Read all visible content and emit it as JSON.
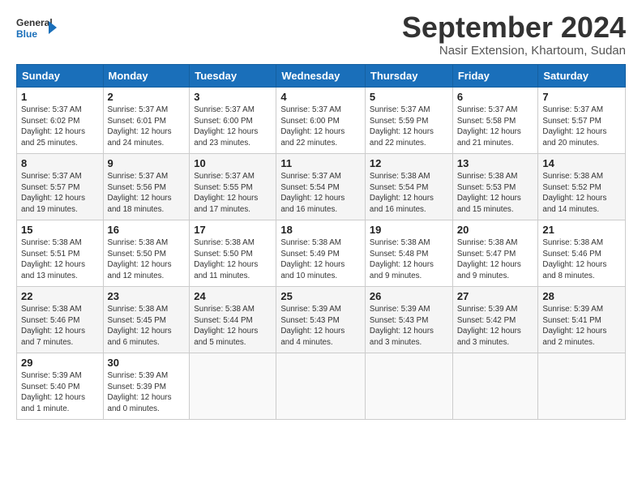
{
  "logo": {
    "line1": "General",
    "line2": "Blue"
  },
  "title": "September 2024",
  "location": "Nasir Extension, Khartoum, Sudan",
  "days_of_week": [
    "Sunday",
    "Monday",
    "Tuesday",
    "Wednesday",
    "Thursday",
    "Friday",
    "Saturday"
  ],
  "weeks": [
    [
      {
        "day": "1",
        "info": "Sunrise: 5:37 AM\nSunset: 6:02 PM\nDaylight: 12 hours\nand 25 minutes."
      },
      {
        "day": "2",
        "info": "Sunrise: 5:37 AM\nSunset: 6:01 PM\nDaylight: 12 hours\nand 24 minutes."
      },
      {
        "day": "3",
        "info": "Sunrise: 5:37 AM\nSunset: 6:00 PM\nDaylight: 12 hours\nand 23 minutes."
      },
      {
        "day": "4",
        "info": "Sunrise: 5:37 AM\nSunset: 6:00 PM\nDaylight: 12 hours\nand 22 minutes."
      },
      {
        "day": "5",
        "info": "Sunrise: 5:37 AM\nSunset: 5:59 PM\nDaylight: 12 hours\nand 22 minutes."
      },
      {
        "day": "6",
        "info": "Sunrise: 5:37 AM\nSunset: 5:58 PM\nDaylight: 12 hours\nand 21 minutes."
      },
      {
        "day": "7",
        "info": "Sunrise: 5:37 AM\nSunset: 5:57 PM\nDaylight: 12 hours\nand 20 minutes."
      }
    ],
    [
      {
        "day": "8",
        "info": "Sunrise: 5:37 AM\nSunset: 5:57 PM\nDaylight: 12 hours\nand 19 minutes."
      },
      {
        "day": "9",
        "info": "Sunrise: 5:37 AM\nSunset: 5:56 PM\nDaylight: 12 hours\nand 18 minutes."
      },
      {
        "day": "10",
        "info": "Sunrise: 5:37 AM\nSunset: 5:55 PM\nDaylight: 12 hours\nand 17 minutes."
      },
      {
        "day": "11",
        "info": "Sunrise: 5:37 AM\nSunset: 5:54 PM\nDaylight: 12 hours\nand 16 minutes."
      },
      {
        "day": "12",
        "info": "Sunrise: 5:38 AM\nSunset: 5:54 PM\nDaylight: 12 hours\nand 16 minutes."
      },
      {
        "day": "13",
        "info": "Sunrise: 5:38 AM\nSunset: 5:53 PM\nDaylight: 12 hours\nand 15 minutes."
      },
      {
        "day": "14",
        "info": "Sunrise: 5:38 AM\nSunset: 5:52 PM\nDaylight: 12 hours\nand 14 minutes."
      }
    ],
    [
      {
        "day": "15",
        "info": "Sunrise: 5:38 AM\nSunset: 5:51 PM\nDaylight: 12 hours\nand 13 minutes."
      },
      {
        "day": "16",
        "info": "Sunrise: 5:38 AM\nSunset: 5:50 PM\nDaylight: 12 hours\nand 12 minutes."
      },
      {
        "day": "17",
        "info": "Sunrise: 5:38 AM\nSunset: 5:50 PM\nDaylight: 12 hours\nand 11 minutes."
      },
      {
        "day": "18",
        "info": "Sunrise: 5:38 AM\nSunset: 5:49 PM\nDaylight: 12 hours\nand 10 minutes."
      },
      {
        "day": "19",
        "info": "Sunrise: 5:38 AM\nSunset: 5:48 PM\nDaylight: 12 hours\nand 9 minutes."
      },
      {
        "day": "20",
        "info": "Sunrise: 5:38 AM\nSunset: 5:47 PM\nDaylight: 12 hours\nand 9 minutes."
      },
      {
        "day": "21",
        "info": "Sunrise: 5:38 AM\nSunset: 5:46 PM\nDaylight: 12 hours\nand 8 minutes."
      }
    ],
    [
      {
        "day": "22",
        "info": "Sunrise: 5:38 AM\nSunset: 5:46 PM\nDaylight: 12 hours\nand 7 minutes."
      },
      {
        "day": "23",
        "info": "Sunrise: 5:38 AM\nSunset: 5:45 PM\nDaylight: 12 hours\nand 6 minutes."
      },
      {
        "day": "24",
        "info": "Sunrise: 5:38 AM\nSunset: 5:44 PM\nDaylight: 12 hours\nand 5 minutes."
      },
      {
        "day": "25",
        "info": "Sunrise: 5:39 AM\nSunset: 5:43 PM\nDaylight: 12 hours\nand 4 minutes."
      },
      {
        "day": "26",
        "info": "Sunrise: 5:39 AM\nSunset: 5:43 PM\nDaylight: 12 hours\nand 3 minutes."
      },
      {
        "day": "27",
        "info": "Sunrise: 5:39 AM\nSunset: 5:42 PM\nDaylight: 12 hours\nand 3 minutes."
      },
      {
        "day": "28",
        "info": "Sunrise: 5:39 AM\nSunset: 5:41 PM\nDaylight: 12 hours\nand 2 minutes."
      }
    ],
    [
      {
        "day": "29",
        "info": "Sunrise: 5:39 AM\nSunset: 5:40 PM\nDaylight: 12 hours\nand 1 minute."
      },
      {
        "day": "30",
        "info": "Sunrise: 5:39 AM\nSunset: 5:39 PM\nDaylight: 12 hours\nand 0 minutes."
      },
      null,
      null,
      null,
      null,
      null
    ]
  ]
}
